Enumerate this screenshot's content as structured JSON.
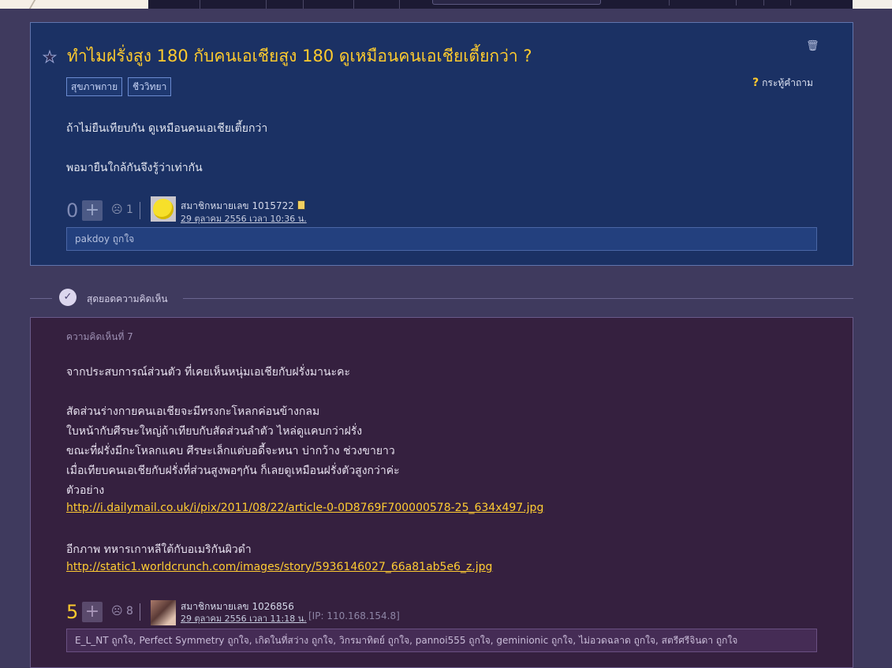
{
  "question": {
    "title": "ทำไมฝรั่งสูง 180 กับคนเอเชียสูง 180 ดูเหมือนคนเอเชียเตี้ยกว่า ?",
    "tags": [
      "สุขภาพกาย",
      "ชีววิทยา"
    ],
    "ask_label": "กระทู้คำถาม",
    "body": [
      "ถ้าไม่ยืนเทียบกัน  ดูเหมือนคนเอเชียเตี้ยกว่า",
      "พอมายืนใกล้กันจึงรู้ว่าเท่ากัน"
    ],
    "score": "0",
    "emotion_count": "1",
    "author": "สมาชิกหมายเลข 1015722",
    "date": "29 ตุลาคม 2556 เวลา 10:36 น.",
    "likes": "pakdoy ถูกใจ"
  },
  "section": {
    "label": "สุดยอดความคิดเห็น"
  },
  "comment": {
    "number": "ความคิดเห็นที่ 7",
    "lines": [
      "จากประสบการณ์ส่วนตัว ที่เคยเห็นหนุ่มเอเชียกับฝรั่งมานะคะ",
      "สัดส่วนร่างกายคนเอเชียจะมีทรงกะโหลกค่อนข้างกลม",
      "ใบหน้ากับศีรษะใหญ่ถ้าเทียบกับสัดส่วนลำตัว ไหล่ดูแคบกว่าฝรั่ง",
      "ขณะที่ฝรั่งมีกะโหลกแคบ ศีรษะเล็กแต่บอดี้จะหนา บ่ากว้าง ช่วงขายาว",
      "เมื่อเทียบคนเอเชียกับฝรั่งที่ส่วนสูงพอๆกัน ก็เลยดูเหมือนฝรั่งตัวสูงกว่าค่ะ",
      "ตัวอย่าง"
    ],
    "link1": "http://i.dailymail.co.uk/i/pix/2011/08/22/article-0-0D8769F700000578-25_634x497.jpg",
    "line_after": "อีกภาพ ทหารเกาหลีใต้กับอเมริกันผิวดำ",
    "link2": "http://static1.worldcrunch.com/images/story/5936146027_66a81ab5e6_z.jpg",
    "score": "5",
    "emotion_count": "8",
    "author": "สมาชิกหมายเลข 1026856",
    "date": "29 ตุลาคม 2556 เวลา 11:18 น.",
    "ip": "[IP: 110.168.154.8]",
    "likes": "E_L_NT ถูกใจ, Perfect Symmetry ถูกใจ, เกิดในที่สว่าง ถูกใจ, วิกรมาทิตย์ ถูกใจ, pannoi555 ถูกใจ, geminionic ถูกใจ, ไม่อวดฉลาด ถูกใจ, สตรีศรีจินดา ถูกใจ"
  },
  "colors": {
    "title": "#ffcb2e",
    "question_bg": "#1b3164",
    "comment_bg": "#35203f",
    "page_bg": "#3f3a5e"
  },
  "icons": [
    "star-icon",
    "trash-icon",
    "question-mark-icon",
    "plus-icon",
    "emotion-icon",
    "speech-bubble-icon",
    "badge-icon"
  ]
}
